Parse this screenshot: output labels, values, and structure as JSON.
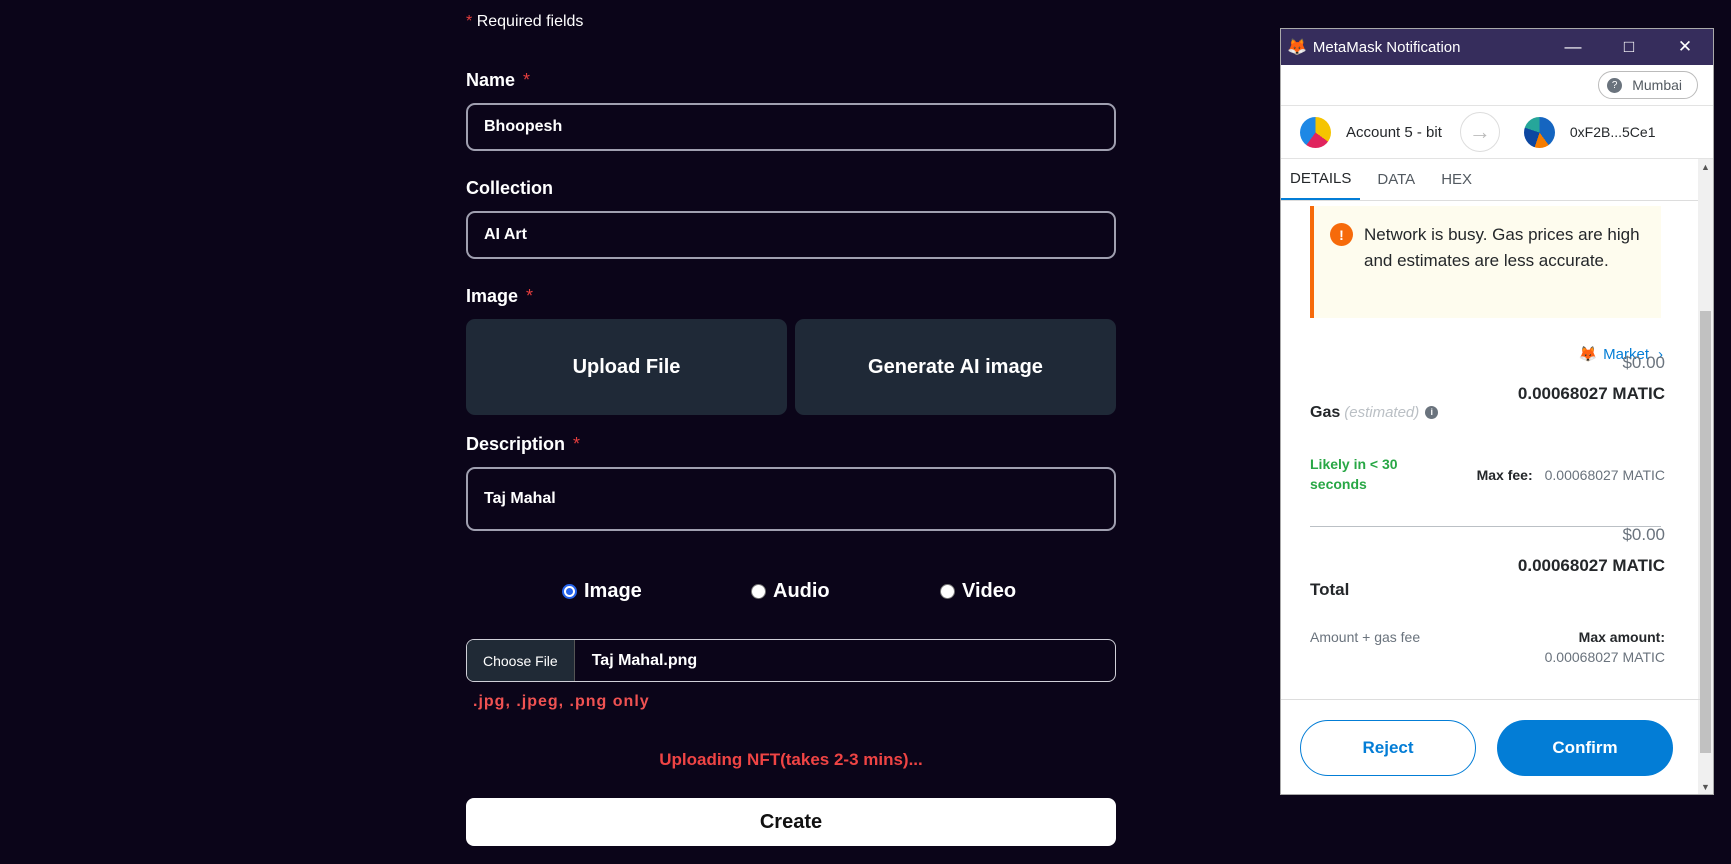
{
  "form": {
    "required_note": "Required fields",
    "required_star": "*",
    "name": {
      "label": "Name",
      "value": "Bhoopesh"
    },
    "collection": {
      "label": "Collection",
      "value": "AI Art"
    },
    "image": {
      "label": "Image",
      "upload_label": "Upload File",
      "generate_label": "Generate AI image"
    },
    "description": {
      "label": "Description",
      "value": "Taj Mahal"
    },
    "media_types": [
      {
        "label": "Image",
        "selected": true
      },
      {
        "label": "Audio",
        "selected": false
      },
      {
        "label": "Video",
        "selected": false
      }
    ],
    "file": {
      "button_label": "Choose File",
      "filename": "Taj Mahal.png",
      "hint": ".jpg, .jpeg, .png only"
    },
    "status": "Uploading NFT(takes 2-3 mins)...",
    "create_label": "Create"
  },
  "metamask": {
    "window_title": "MetaMask Notification",
    "network": "Mumbai",
    "from_account": "Account 5 - bit",
    "to_address": "0xF2B...5Ce1",
    "tabs": [
      "DETAILS",
      "DATA",
      "HEX"
    ],
    "warning": "Network is busy. Gas prices are high and estimates are less accurate.",
    "market_label": "Market",
    "gas": {
      "label": "Gas",
      "estimated_label": "(estimated)",
      "usd": "$0.00",
      "amount": "0.00068027 MATIC",
      "likely": "Likely in < 30 seconds",
      "max_fee_label": "Max fee:",
      "max_fee_value": "0.00068027 MATIC"
    },
    "total": {
      "label": "Total",
      "usd": "$0.00",
      "amount": "0.00068027 MATIC",
      "amount_gas_label": "Amount + gas fee",
      "max_amount_label": "Max amount:",
      "max_amount_value": "0.00068027 MATIC"
    },
    "reject_label": "Reject",
    "confirm_label": "Confirm"
  },
  "colors": {
    "page_bg": "#0b0519",
    "required_star": "#e53e3e",
    "status_red": "#ef4444",
    "metamask_blue": "#037dd6",
    "warning_orange": "#f66a0a",
    "likely_green": "#28a745",
    "titlebar": "#362d5c"
  },
  "icons": {
    "metamask": "fox-icon",
    "help": "question-icon",
    "arrow": "arrow-right-icon",
    "warning": "exclamation-icon",
    "info": "info-icon",
    "chevron": "chevron-right-icon"
  }
}
